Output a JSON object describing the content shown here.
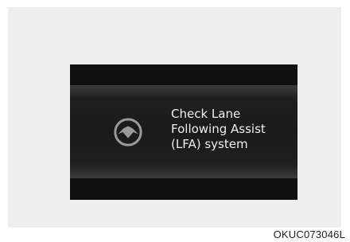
{
  "display": {
    "icon": "lfa-steering-wheel-icon",
    "message_lines": [
      "Check Lane",
      "Following Assist",
      "(LFA) system"
    ]
  },
  "reference_code": "OKUC073046L",
  "colors": {
    "background": "#eeeeee",
    "display_black": "#0c0c0c",
    "icon_gray": "#9a9a9a",
    "text": "#eeeeee"
  }
}
